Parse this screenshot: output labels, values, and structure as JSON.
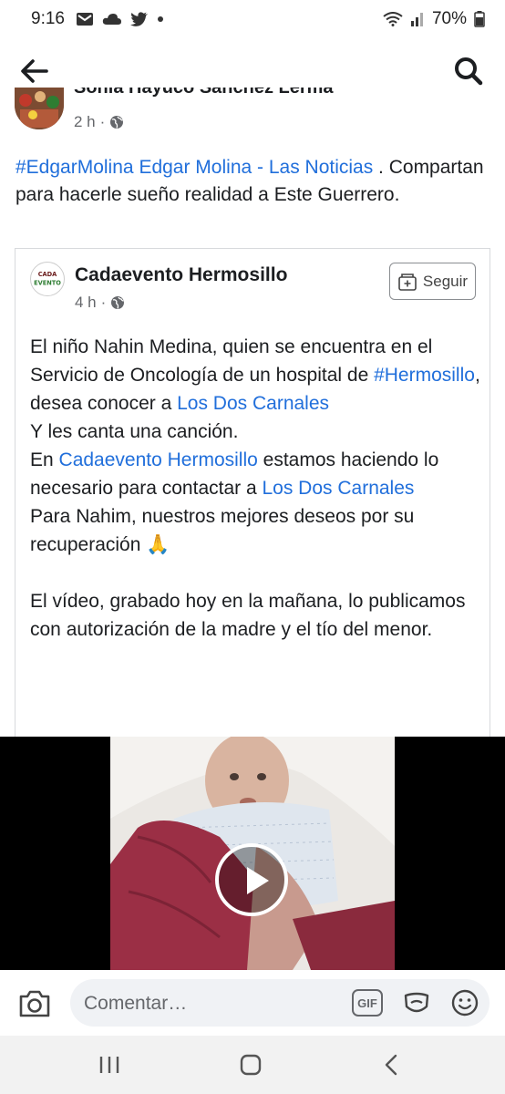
{
  "status_bar": {
    "time": "9:16",
    "battery": "70%"
  },
  "post": {
    "author_name": "Sonia Hayuco Sánchez Lerma",
    "time": "2 h",
    "text": {
      "link1": "#EdgarMolina",
      "space": " ",
      "link2": "Edgar Molina - Las Noticias",
      "rest": " . Compartan para hacerle sueño realidad a Este Guerrero."
    }
  },
  "shared": {
    "page_name": "Cadaevento Hermosillo",
    "time": "4 h",
    "follow_label": "Seguir",
    "avatar_text": "CADA EVENTO",
    "line1_a": "El niño Nahin Medina, quien se encuentra  en el Servicio de Oncología de un hospital de ",
    "line1_link1": "#Hermosillo",
    "line1_b": ", desea conocer a ",
    "line1_link2": "Los Dos Carnales",
    "line2": "Y les canta una canción.",
    "line3_a": "En ",
    "line3_link1": "Cadaevento Hermosillo",
    "line3_b": " estamos haciendo lo necesario para contactar a ",
    "line3_link2": "Los Dos Carnales",
    "line4": "Para Nahim, nuestros mejores deseos por su recuperación 🙏",
    "line5": "El vídeo, grabado hoy en la mañana, lo publicamos con autorización de la madre y el tío del menor."
  },
  "comment": {
    "placeholder": "Comentar…",
    "gif_label": "GIF"
  },
  "icons": {
    "back": "back-arrow-icon",
    "search": "search-icon",
    "camera": "camera-icon",
    "sticker": "sticker-icon",
    "emoji": "emoji-icon",
    "globe": "globe-icon"
  },
  "colors": {
    "link": "#216fdb",
    "text": "#1c1e21",
    "meta": "#65676b",
    "input_bg": "#f0f2f5"
  }
}
